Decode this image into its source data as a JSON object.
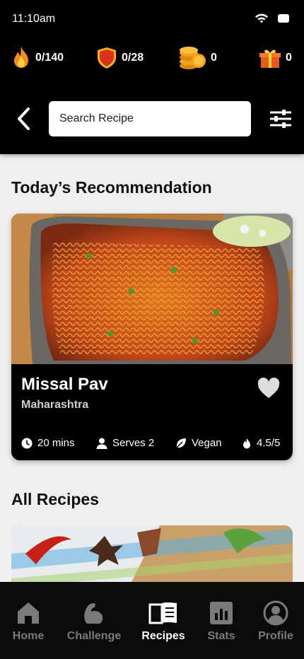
{
  "status": {
    "time": "11:10am",
    "wifi_icon": "wifi-icon",
    "battery_icon": "battery-icon"
  },
  "stats": [
    {
      "icon": "flame-icon",
      "value": "0/140"
    },
    {
      "icon": "shield-icon",
      "value": "0/28"
    },
    {
      "icon": "coins-icon",
      "value": "0"
    },
    {
      "icon": "gift-icon",
      "value": "0"
    }
  ],
  "search": {
    "placeholder": "Search Recipe"
  },
  "recommendation": {
    "heading": "Today’s Recommendation",
    "title": "Missal Pav",
    "region": "Maharashtra",
    "time": "20 mins",
    "serves": "Serves 2",
    "diet": "Vegan",
    "rating": "4.5/5"
  },
  "all_recipes": {
    "heading": "All Recipes"
  },
  "nav": [
    {
      "label": "Home",
      "icon": "home-icon",
      "active": false
    },
    {
      "label": "Challenge",
      "icon": "muscle-icon",
      "active": false
    },
    {
      "label": "Recipes",
      "icon": "book-icon",
      "active": true
    },
    {
      "label": "Stats",
      "icon": "stats-icon",
      "active": false
    },
    {
      "label": "Profile",
      "icon": "profile-icon",
      "active": false
    }
  ],
  "colors": {
    "accent_flame": "#f28c1c",
    "shield": "#d9331c",
    "coin": "#f4a21b",
    "gift": "#e85b1b"
  }
}
